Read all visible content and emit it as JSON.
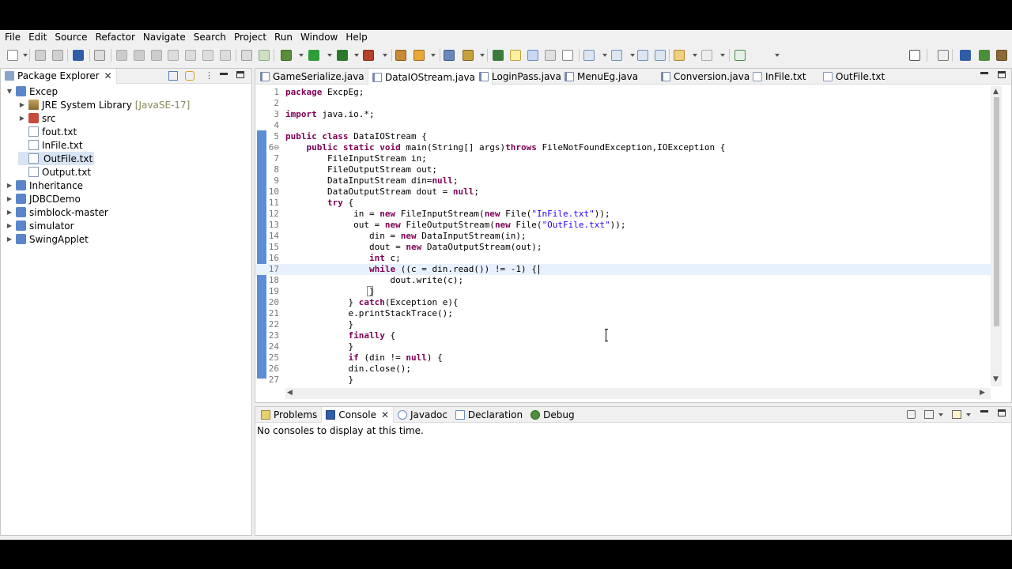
{
  "menu": [
    "File",
    "Edit",
    "Source",
    "Refactor",
    "Navigate",
    "Search",
    "Project",
    "Run",
    "Window",
    "Help"
  ],
  "explorer": {
    "title": "Package Explorer",
    "tree": [
      {
        "label": "Excep",
        "depth": 0,
        "expanded": true,
        "icon": "project-icon"
      },
      {
        "label": "JRE System Library",
        "suffix": "[JavaSE-17]",
        "depth": 1,
        "expanded": false,
        "icon": "library-icon"
      },
      {
        "label": "src",
        "depth": 1,
        "expanded": false,
        "icon": "package-folder-icon"
      },
      {
        "label": "fout.txt",
        "depth": 1,
        "icon": "text-file-icon"
      },
      {
        "label": "InFile.txt",
        "depth": 1,
        "icon": "text-file-icon"
      },
      {
        "label": "OutFile.txt",
        "depth": 1,
        "icon": "text-file-icon",
        "selected": true
      },
      {
        "label": "Output.txt",
        "depth": 1,
        "icon": "text-file-icon"
      },
      {
        "label": "Inheritance",
        "depth": 0,
        "expanded": false,
        "icon": "project-icon"
      },
      {
        "label": "JDBCDemo",
        "depth": 0,
        "expanded": false,
        "icon": "project-icon"
      },
      {
        "label": "simblock-master",
        "depth": 0,
        "expanded": false,
        "icon": "project-icon"
      },
      {
        "label": "simulator",
        "depth": 0,
        "expanded": false,
        "icon": "project-icon"
      },
      {
        "label": "SwingApplet",
        "depth": 0,
        "expanded": false,
        "icon": "project-icon"
      }
    ]
  },
  "editor": {
    "tabs": [
      {
        "label": "GameSerialize.java",
        "icon": "java-file-icon"
      },
      {
        "label": "DataIOStream.java",
        "icon": "java-file-icon",
        "active": true
      },
      {
        "label": "LoginPass.java",
        "icon": "java-file-icon"
      },
      {
        "label": "MenuEg.java",
        "icon": "java-file-icon"
      },
      {
        "label": "Conversion.java",
        "icon": "java-file-icon"
      },
      {
        "label": "InFile.txt",
        "icon": "text-file-icon"
      },
      {
        "label": "OutFile.txt",
        "icon": "text-file-icon"
      }
    ],
    "lines": [
      {
        "n": "1",
        "segs": [
          {
            "t": "package",
            "k": "kw"
          },
          {
            "t": " ExcpEg;"
          }
        ]
      },
      {
        "n": "2",
        "segs": []
      },
      {
        "n": "3",
        "segs": [
          {
            "t": "import",
            "k": "kw"
          },
          {
            "t": " java.io.*;"
          }
        ]
      },
      {
        "n": "4",
        "segs": []
      },
      {
        "n": "5",
        "segs": [
          {
            "t": "public class",
            "k": "kw"
          },
          {
            "t": " DataIOStream {"
          }
        ]
      },
      {
        "n": "6⊖",
        "segs": [
          {
            "t": "    "
          },
          {
            "t": "public static void",
            "k": "kw"
          },
          {
            "t": " main(String[] args)"
          },
          {
            "t": "throws",
            "k": "kw"
          },
          {
            "t": " FileNotFoundException,IOException {"
          }
        ]
      },
      {
        "n": "7",
        "segs": [
          {
            "t": "        FileInputStream in;"
          }
        ]
      },
      {
        "n": "8",
        "segs": [
          {
            "t": "        FileOutputStream out;"
          }
        ]
      },
      {
        "n": "9",
        "segs": [
          {
            "t": "        DataInputStream din="
          },
          {
            "t": "null",
            "k": "kw"
          },
          {
            "t": ";"
          }
        ]
      },
      {
        "n": "10",
        "segs": [
          {
            "t": "        DataOutputStream dout = "
          },
          {
            "t": "null",
            "k": "kw"
          },
          {
            "t": ";"
          }
        ]
      },
      {
        "n": "11",
        "segs": [
          {
            "t": "        "
          },
          {
            "t": "try",
            "k": "kw"
          },
          {
            "t": " {"
          }
        ]
      },
      {
        "n": "12",
        "segs": [
          {
            "t": "             in = "
          },
          {
            "t": "new",
            "k": "kw"
          },
          {
            "t": " FileInputStream("
          },
          {
            "t": "new",
            "k": "kw"
          },
          {
            "t": " File("
          },
          {
            "t": "\"InFile.txt\"",
            "k": "str"
          },
          {
            "t": "));"
          }
        ]
      },
      {
        "n": "13",
        "segs": [
          {
            "t": "             out = "
          },
          {
            "t": "new",
            "k": "kw"
          },
          {
            "t": " FileOutputStream("
          },
          {
            "t": "new",
            "k": "kw"
          },
          {
            "t": " File("
          },
          {
            "t": "\"OutFile.txt\"",
            "k": "str"
          },
          {
            "t": "));"
          }
        ]
      },
      {
        "n": "14",
        "segs": [
          {
            "t": "                din = "
          },
          {
            "t": "new",
            "k": "kw"
          },
          {
            "t": " DataInputStream(in);"
          }
        ]
      },
      {
        "n": "15",
        "segs": [
          {
            "t": "                dout = "
          },
          {
            "t": "new",
            "k": "kw"
          },
          {
            "t": " DataOutputStream(out);"
          }
        ]
      },
      {
        "n": "16",
        "segs": [
          {
            "t": "                "
          },
          {
            "t": "int",
            "k": "kw"
          },
          {
            "t": " c;"
          }
        ]
      },
      {
        "n": "17",
        "segs": [
          {
            "t": "                "
          },
          {
            "t": "while",
            "k": "kw"
          },
          {
            "t": " ((c = din.read()) != -1) {"
          }
        ]
      },
      {
        "n": "18",
        "segs": [
          {
            "t": "                    dout.write(c);"
          }
        ]
      },
      {
        "n": "19",
        "segs": [
          {
            "t": "                }"
          }
        ]
      },
      {
        "n": "20",
        "segs": [
          {
            "t": "            } "
          },
          {
            "t": "catch",
            "k": "kw"
          },
          {
            "t": "(Exception e){"
          }
        ]
      },
      {
        "n": "21",
        "segs": [
          {
            "t": "            e.printStackTrace();"
          }
        ]
      },
      {
        "n": "22",
        "segs": [
          {
            "t": "            }"
          }
        ]
      },
      {
        "n": "23",
        "segs": [
          {
            "t": "            "
          },
          {
            "t": "finally",
            "k": "kw"
          },
          {
            "t": " {"
          }
        ]
      },
      {
        "n": "24",
        "segs": [
          {
            "t": "            }"
          }
        ]
      },
      {
        "n": "25",
        "segs": [
          {
            "t": "            "
          },
          {
            "t": "if",
            "k": "kw"
          },
          {
            "t": " (din != "
          },
          {
            "t": "null",
            "k": "kw"
          },
          {
            "t": ") {"
          }
        ]
      },
      {
        "n": "26",
        "segs": [
          {
            "t": "            din.close();"
          }
        ]
      },
      {
        "n": "27",
        "segs": [
          {
            "t": "            }"
          }
        ]
      }
    ]
  },
  "bottom": {
    "tabs": [
      {
        "label": "Problems",
        "icon": "problems-icon"
      },
      {
        "label": "Console",
        "icon": "console-icon",
        "active": true
      },
      {
        "label": "Javadoc",
        "icon": "javadoc-icon"
      },
      {
        "label": "Declaration",
        "icon": "declaration-icon"
      },
      {
        "label": "Debug",
        "icon": "debug-icon"
      }
    ],
    "console_message": "No consoles to display at this time."
  },
  "colors": {
    "keyword": "#7f0055",
    "string": "#2a00ff",
    "selection": "#d8e4f4",
    "current_line": "#e8f2fe"
  }
}
